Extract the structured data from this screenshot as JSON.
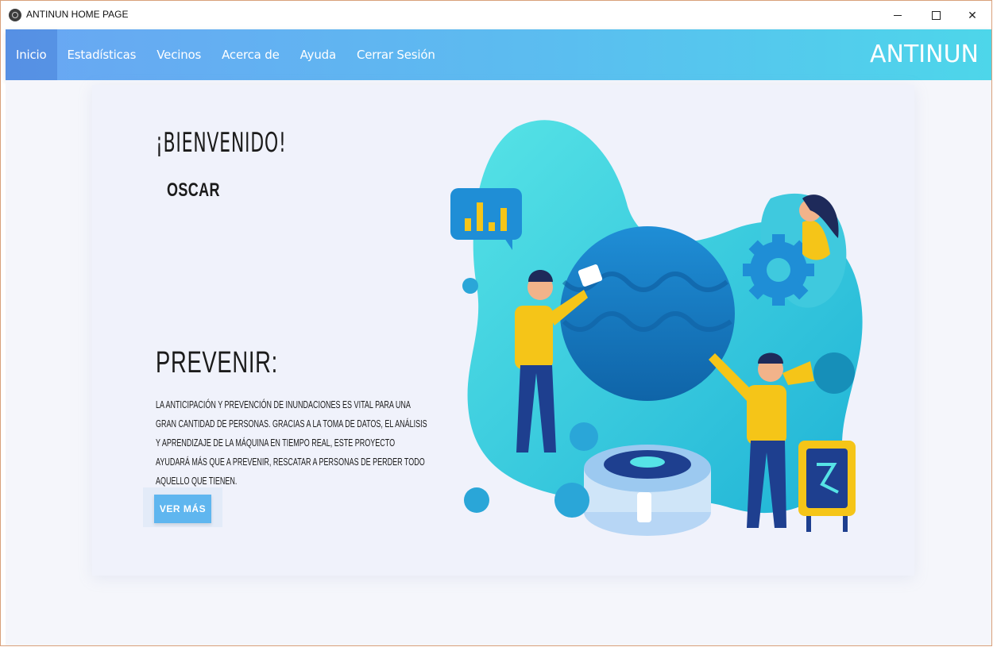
{
  "window": {
    "title": "ANTINUN HOME PAGE",
    "controls": {
      "minimize": "",
      "maximize": "",
      "close": "✕"
    }
  },
  "nav": {
    "items": [
      {
        "label": "Inicio",
        "active": true
      },
      {
        "label": "Estadísticas",
        "active": false
      },
      {
        "label": "Vecinos",
        "active": false
      },
      {
        "label": "Acerca de",
        "active": false
      },
      {
        "label": "Ayuda",
        "active": false
      },
      {
        "label": "Cerrar Sesión",
        "active": false
      }
    ],
    "brand": "ANTINUN"
  },
  "hero": {
    "welcome": "¡BIENVENIDO!",
    "username": "OSCAR",
    "prevent_title": "PREVENIR:",
    "prevent_text": "La anticipación y prevención de inundaciones es vital para una gran cantidad de personas. Gracias a la toma de datos, el análisis y aprendizaje de la máquina en tiempo real, este proyecto ayudará más que a prevenir, rescatar a personas de perder todo aquello que tienen.",
    "button_label": "VER MÁS"
  },
  "colors": {
    "nav_start": "#69a6f3",
    "nav_end": "#4dd6ea",
    "button": "#5fb6ef",
    "accent_yellow": "#f5c518",
    "globe": "#1b78c2"
  },
  "icons": [
    "app-logo-icon",
    "minimize-icon",
    "maximize-icon",
    "close-icon"
  ]
}
